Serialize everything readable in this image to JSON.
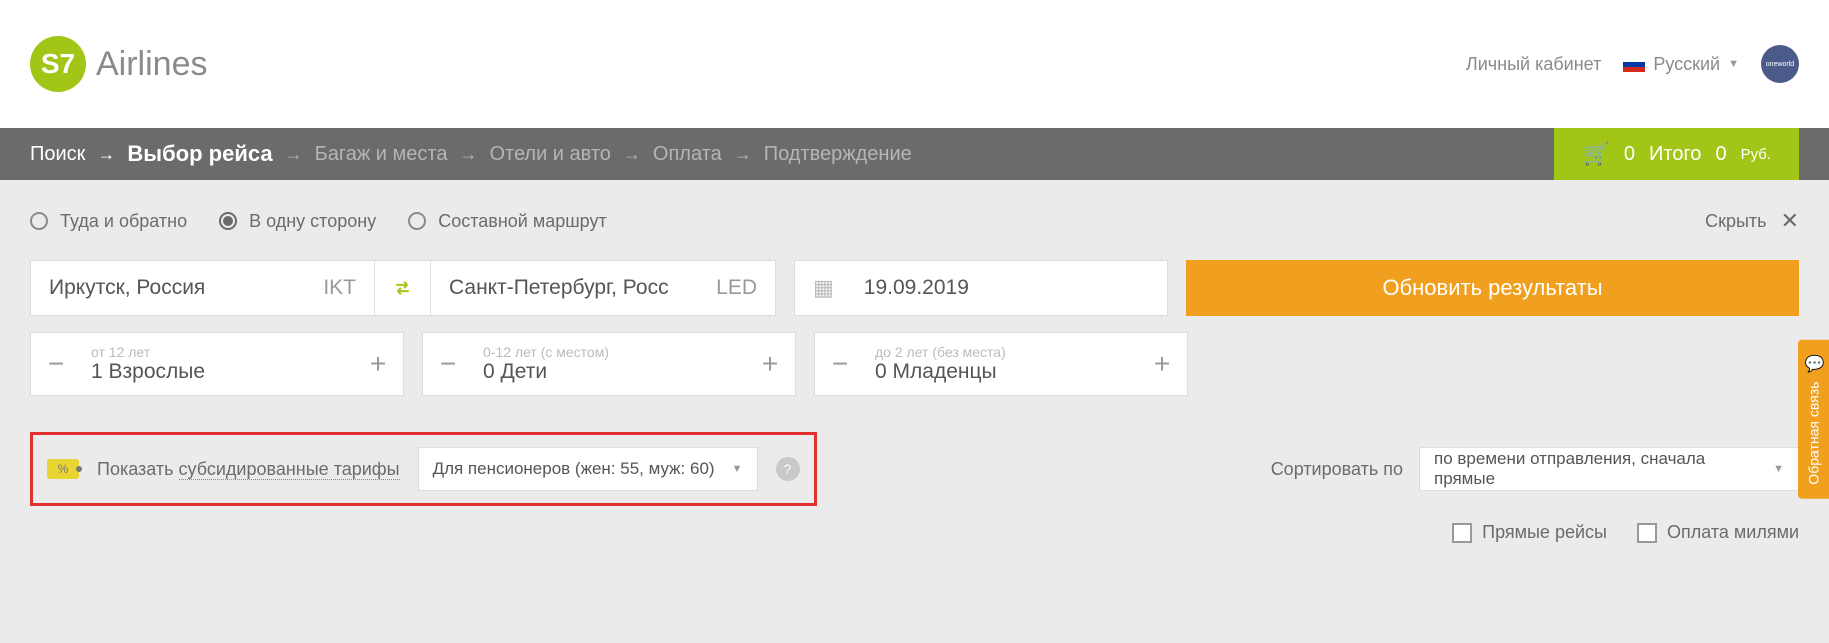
{
  "header": {
    "logo_abbr": "S7",
    "logo_text": "Airlines",
    "account": "Личный кабинет",
    "language": "Русский",
    "oneworld": "oneworld"
  },
  "breadcrumb": {
    "items": [
      "Поиск",
      "Выбор рейса",
      "Багаж и места",
      "Отели и авто",
      "Оплата",
      "Подтверждение"
    ],
    "active_index": 1
  },
  "cart": {
    "count": "0",
    "total_label": "Итого",
    "total_value": "0",
    "currency": "Руб."
  },
  "trip_type": {
    "options": [
      "Туда и обратно",
      "В одну сторону",
      "Составной маршрут"
    ],
    "selected_index": 1,
    "hide_label": "Скрыть"
  },
  "route": {
    "from_city": "Иркутск, Россия",
    "from_code": "IKT",
    "to_city": "Санкт-Петербург, Росс",
    "to_code": "LED",
    "date": "19.09.2019",
    "update_btn": "Обновить результаты"
  },
  "passengers": {
    "adults": {
      "hint": "от 12 лет",
      "count": "1",
      "label": "Взрослые"
    },
    "children": {
      "hint": "0-12 лет (с местом)",
      "count": "0",
      "label": "Дети"
    },
    "infants": {
      "hint": "до 2 лет (без места)",
      "count": "0",
      "label": "Младенцы"
    }
  },
  "subsidy": {
    "show_label_pre": "Показать",
    "show_label_link": "субсидированные тарифы",
    "selected": "Для пенсионеров (жен: 55, муж: 60)"
  },
  "sort": {
    "label": "Сортировать по",
    "selected": "по времени отправления, сначала прямые"
  },
  "filters": {
    "direct": "Прямые рейсы",
    "miles": "Оплата милями"
  },
  "feedback": "Обратная связь"
}
